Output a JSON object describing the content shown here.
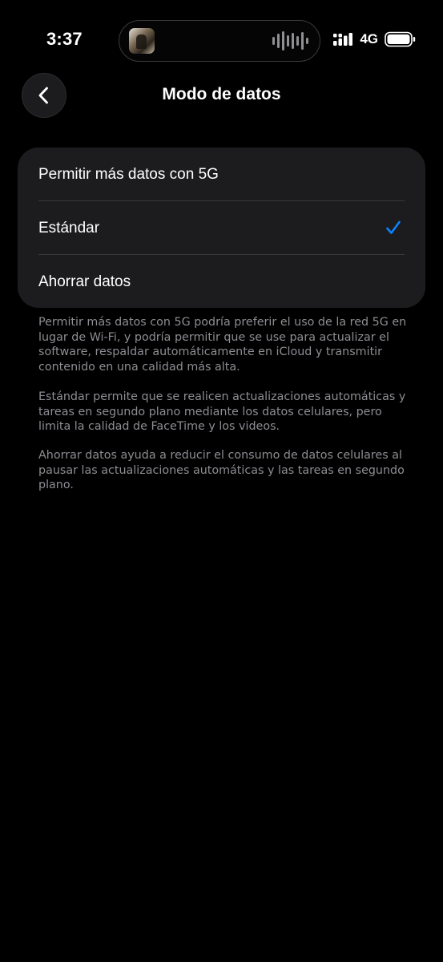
{
  "status_bar": {
    "time": "3:37",
    "network": "4G",
    "signal_icon": "signal-bars-icon",
    "battery_icon": "battery-icon"
  },
  "nav": {
    "back_icon": "chevron-left-icon",
    "title": "Modo de datos"
  },
  "options": [
    {
      "label": "Permitir más datos con 5G",
      "selected": false
    },
    {
      "label": "Estándar",
      "selected": true
    },
    {
      "label": "Ahorrar datos",
      "selected": false
    }
  ],
  "descriptions": [
    "Permitir más datos con 5G podría preferir el uso de la red 5G en lugar de Wi-Fi, y podría permitir que se use para actualizar el software, respaldar automáticamente en iCloud y transmitir contenido en una calidad más alta.",
    "Estándar permite que se realicen actualizaciones automáticas y tareas en segundo plano mediante los datos celulares, pero limita la calidad de FaceTime y los videos.",
    "Ahorrar datos ayuda a reducir el consumo de datos celulares al pausar las actualizaciones automáticas y las tareas en segundo plano."
  ],
  "colors": {
    "background": "#000000",
    "group_background": "#1c1c1e",
    "accent": "#0a84ff",
    "secondary_text": "#8d8d93"
  }
}
